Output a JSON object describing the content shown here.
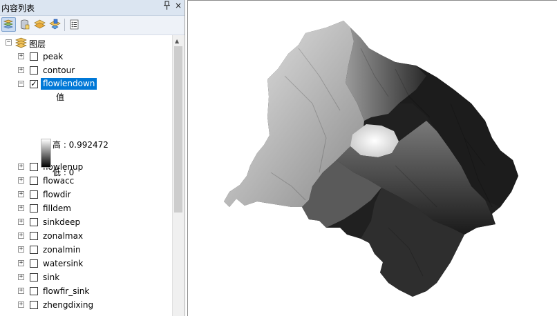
{
  "toc": {
    "title": "内容列表",
    "pin": "ᵽ",
    "close": "×",
    "toolbar": [
      {
        "name": "list-by-drawing-order",
        "icon": "drawing-order-icon",
        "active": true
      },
      {
        "name": "list-by-source",
        "icon": "database-icon",
        "active": false
      },
      {
        "name": "list-by-visibility",
        "icon": "layers-icon",
        "active": false
      },
      {
        "name": "list-by-selection",
        "icon": "selection-icon",
        "active": false
      },
      {
        "name": "options",
        "icon": "options-icon",
        "active": false
      }
    ],
    "root": {
      "label": "图层",
      "expander": "−"
    },
    "layers": [
      {
        "label": "peak",
        "checked": false,
        "expanded": false
      },
      {
        "label": "contour",
        "checked": false,
        "expanded": false
      },
      {
        "label": "flowlendown",
        "checked": true,
        "expanded": true,
        "selected": true
      },
      {
        "label": "flowlenup",
        "checked": false,
        "expanded": false
      },
      {
        "label": "flowacc",
        "checked": false,
        "expanded": false
      },
      {
        "label": "flowdir",
        "checked": false,
        "expanded": false
      },
      {
        "label": "filldem",
        "checked": false,
        "expanded": false
      },
      {
        "label": "sinkdeep",
        "checked": false,
        "expanded": false
      },
      {
        "label": "zonalmax",
        "checked": false,
        "expanded": false
      },
      {
        "label": "zonalmin",
        "checked": false,
        "expanded": false
      },
      {
        "label": "watersink",
        "checked": false,
        "expanded": false
      },
      {
        "label": "sink",
        "checked": false,
        "expanded": false
      },
      {
        "label": "flowfir_sink",
        "checked": false,
        "expanded": false
      },
      {
        "label": "zhengdixing",
        "checked": false,
        "expanded": false
      }
    ],
    "legend": {
      "field": "值",
      "high": "高 : 0.992472",
      "low": "低 : 0"
    },
    "selection_color": "#0078d7",
    "header_color": "#dbe5f1"
  }
}
